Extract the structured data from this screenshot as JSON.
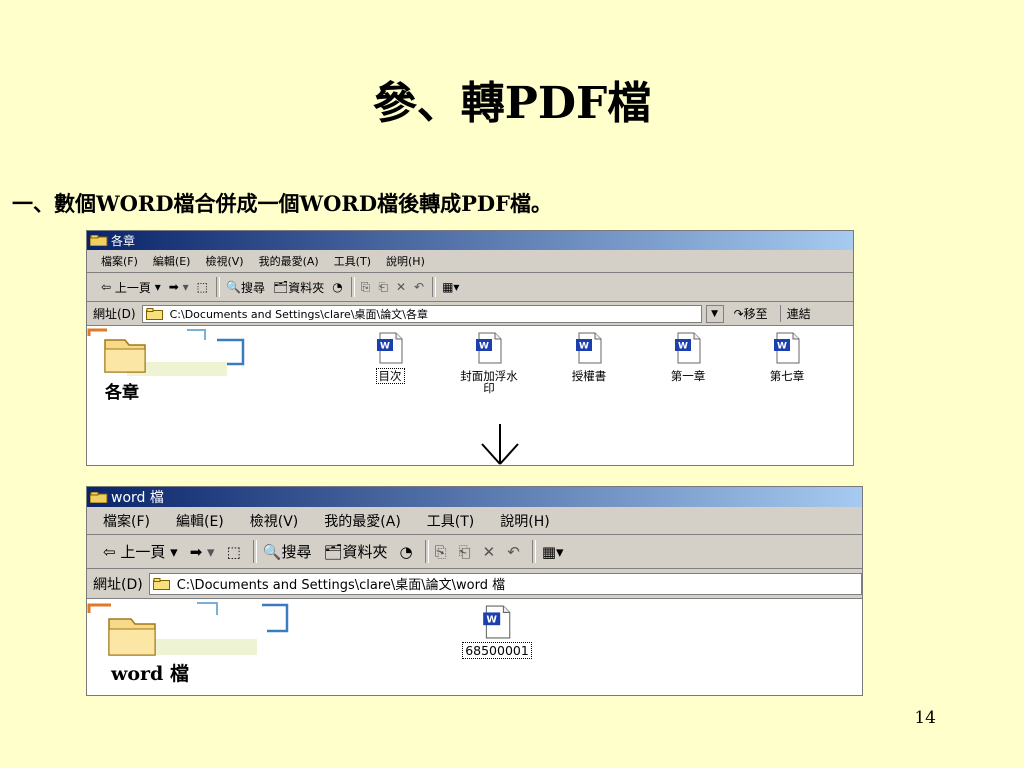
{
  "slide": {
    "title": "參、轉PDF檔",
    "subtitle": "一、數個WORD檔合併成一個WORD檔後轉成PDF檔。",
    "page_number": "14"
  },
  "window_top": {
    "title": "各章",
    "menu": [
      "檔案(F)",
      "編輯(E)",
      "檢視(V)",
      "我的最愛(A)",
      "工具(T)",
      "說明(H)"
    ],
    "toolbar": {
      "back": "上一頁",
      "search": "搜尋",
      "folders": "資料夾"
    },
    "address_label": "網址(D)",
    "address_value": "C:\\Documents and Settings\\clare\\桌面\\論文\\各章",
    "goto_label": "移至",
    "links_label": "連結",
    "folder_name": "各章",
    "files": [
      {
        "name": "目次",
        "selected": true
      },
      {
        "name": "封面加浮水印",
        "selected": false
      },
      {
        "name": "授權書",
        "selected": false
      },
      {
        "name": "第一章",
        "selected": false
      },
      {
        "name": "第七章",
        "selected": false
      }
    ]
  },
  "window_bottom": {
    "title": "word 檔",
    "menu": [
      "檔案(F)",
      "編輯(E)",
      "檢視(V)",
      "我的最愛(A)",
      "工具(T)",
      "說明(H)"
    ],
    "toolbar": {
      "back": "上一頁",
      "search": "搜尋",
      "folders": "資料夾"
    },
    "address_label": "網址(D)",
    "address_value": "C:\\Documents and Settings\\clare\\桌面\\論文\\word 檔",
    "folder_name": "word 檔",
    "files": [
      {
        "name": "68500001",
        "selected": true
      }
    ]
  },
  "colors": {
    "background": "#ffffcc",
    "titlebar_start": "#0a246a",
    "titlebar_end": "#a6caf0",
    "chrome": "#d4d0c8"
  },
  "icons": [
    "folder-icon",
    "word-document-icon",
    "down-arrow-icon"
  ]
}
